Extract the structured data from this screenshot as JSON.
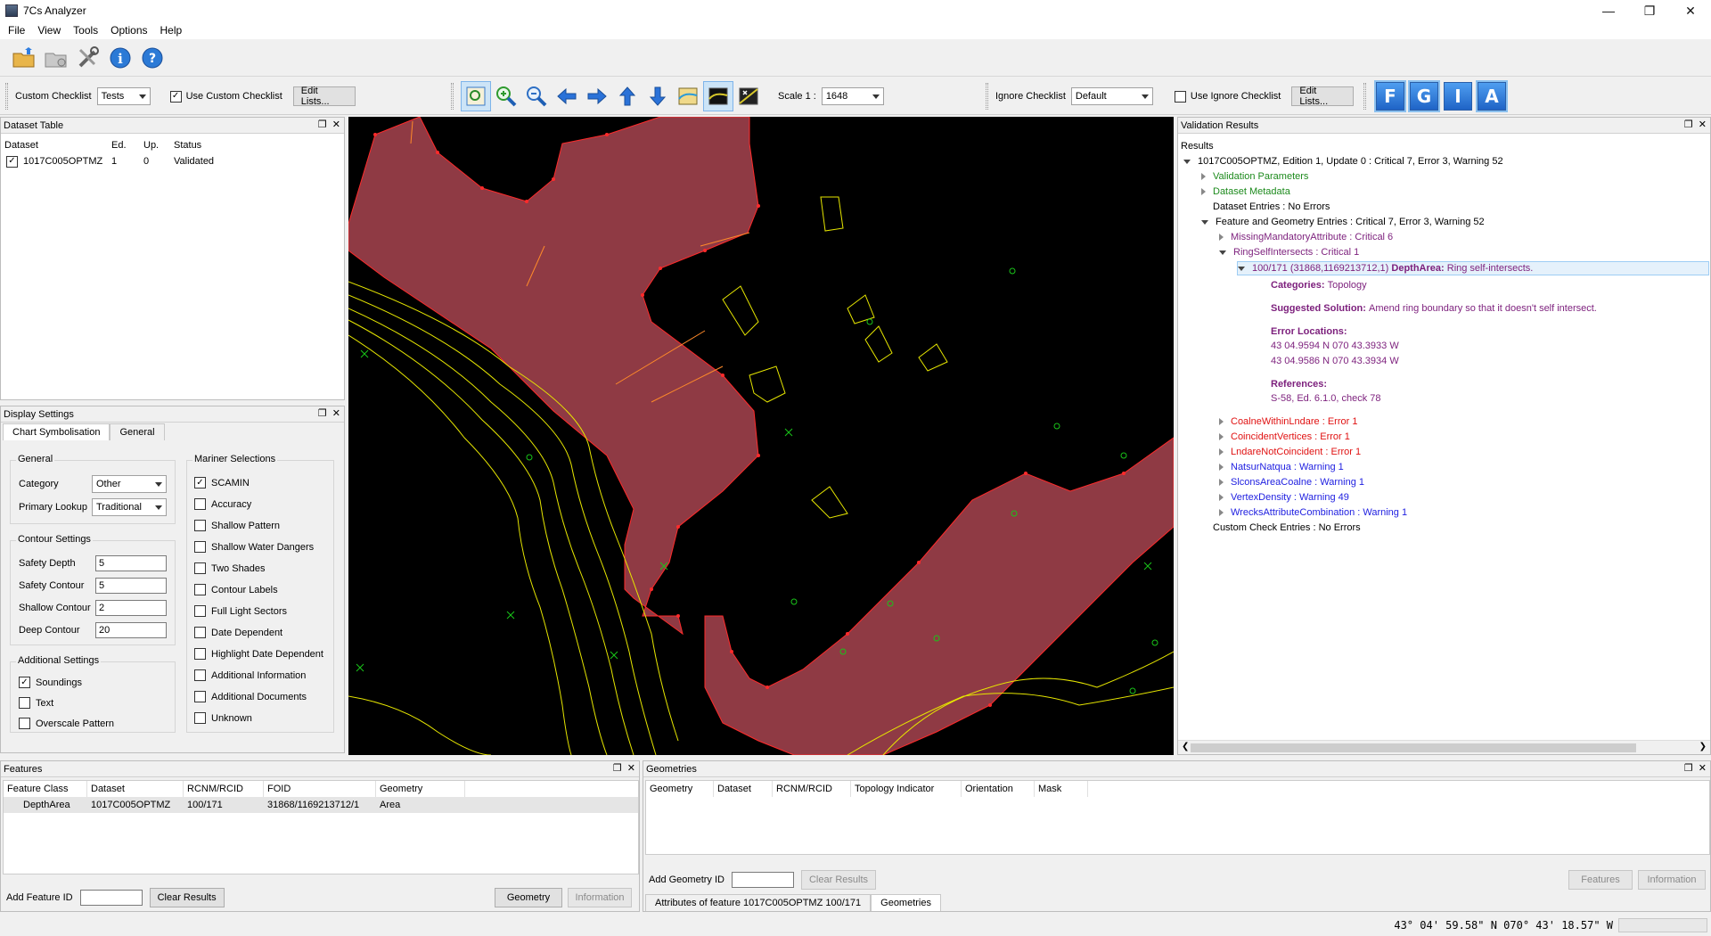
{
  "window": {
    "title": "7Cs Analyzer"
  },
  "menu": [
    "File",
    "View",
    "Tools",
    "Options",
    "Help"
  ],
  "toolbar1": {
    "icons": [
      "open-folder-icon",
      "close-dataset-icon",
      "tools-icon",
      "info-icon",
      "help-icon"
    ]
  },
  "toolbar2": {
    "custom_checklist_label": "Custom Checklist",
    "custom_checklist_value": "Tests",
    "use_custom_checklist_label": "Use Custom Checklist",
    "use_custom_checklist_checked": true,
    "edit_lists_label": "Edit Lists...",
    "scale_label": "Scale 1 :",
    "scale_value": "1648",
    "ignore_checklist_label": "Ignore Checklist",
    "ignore_checklist_value": "Default",
    "use_ignore_checklist_label": "Use Ignore Checklist",
    "use_ignore_checklist_checked": false,
    "edit_lists2_label": "Edit Lists...",
    "letter_buttons": [
      "F",
      "G",
      "I",
      "A"
    ]
  },
  "dataset_table": {
    "title": "Dataset Table",
    "columns": [
      "Dataset",
      "Ed.",
      "Up.",
      "Status"
    ],
    "rows": [
      {
        "dataset": "1017C005OPTMZ",
        "ed": "1",
        "up": "0",
        "status": "Validated",
        "checked": true
      }
    ]
  },
  "display_settings": {
    "title": "Display Settings",
    "tabs": [
      "Chart Symbolisation",
      "General"
    ],
    "general_group": "General",
    "category_label": "Category",
    "category_value": "Other",
    "primary_lookup_label": "Primary Lookup",
    "primary_lookup_value": "Traditional",
    "contour_group": "Contour Settings",
    "safety_depth_label": "Safety Depth",
    "safety_depth_value": "5",
    "safety_contour_label": "Safety Contour",
    "safety_contour_value": "5",
    "shallow_contour_label": "Shallow Contour",
    "shallow_contour_value": "2",
    "deep_contour_label": "Deep Contour",
    "deep_contour_value": "20",
    "additional_group": "Additional Settings",
    "additional": [
      {
        "label": "Soundings",
        "checked": true
      },
      {
        "label": "Text",
        "checked": false
      },
      {
        "label": "Overscale Pattern",
        "checked": false
      }
    ],
    "mariner_group": "Mariner Selections",
    "mariner": [
      {
        "label": "SCAMIN",
        "checked": true
      },
      {
        "label": "Accuracy",
        "checked": false
      },
      {
        "label": "Shallow Pattern",
        "checked": false
      },
      {
        "label": "Shallow Water Dangers",
        "checked": false
      },
      {
        "label": "Two Shades",
        "checked": false
      },
      {
        "label": "Contour Labels",
        "checked": false
      },
      {
        "label": "Full Light Sectors",
        "checked": false
      },
      {
        "label": "Date Dependent",
        "checked": false
      },
      {
        "label": "Highlight Date Dependent",
        "checked": false
      },
      {
        "label": "Additional Information",
        "checked": false
      },
      {
        "label": "Additional Documents",
        "checked": false
      },
      {
        "label": "Unknown",
        "checked": false
      }
    ]
  },
  "validation": {
    "title": "Validation Results",
    "results_label": "Results",
    "root": "1017C005OPTMZ, Edition 1, Update 0 : Critical 7, Error 3, Warning 52",
    "validation_parameters": "Validation Parameters",
    "dataset_metadata": "Dataset Metadata",
    "dataset_entries": "Dataset Entries : No Errors",
    "feature_geometry": "Feature and Geometry Entries : Critical 7, Error 3, Warning 52",
    "missing_mandatory": "MissingMandatoryAttribute : Critical 6",
    "ring_self": "RingSelfIntersects : Critical 1",
    "selected_item_prefix": "100/171 (31868,1169213712,1)",
    "selected_item_bold": "DepthArea:",
    "selected_item_suffix": "Ring self-intersects.",
    "categories_label": "Categories:",
    "categories_value": "Topology",
    "solution_label": "Suggested Solution:",
    "solution_value": "Amend ring boundary so that it doesn't self intersect.",
    "locations_label": "Error Locations:",
    "locations": [
      "43 04.9594 N 070 43.3933 W",
      "43 04.9586 N 070 43.3934 W"
    ],
    "references_label": "References:",
    "references_value": "S-58, Ed. 6.1.0, check 78",
    "checks": [
      {
        "label": "CoalneWithinLndare : Error 1",
        "cls": "red"
      },
      {
        "label": "CoincidentVertices : Error 1",
        "cls": "red"
      },
      {
        "label": "LndareNotCoincident : Error 1",
        "cls": "red"
      },
      {
        "label": "NatsurNatqua : Warning 1",
        "cls": "blue"
      },
      {
        "label": "SlconsAreaCoalne : Warning 1",
        "cls": "blue"
      },
      {
        "label": "VertexDensity : Warning 49",
        "cls": "blue"
      },
      {
        "label": "WrecksAttributeCombination : Warning 1",
        "cls": "blue"
      }
    ],
    "custom_check": "Custom Check Entries : No Errors"
  },
  "features": {
    "title": "Features",
    "columns": [
      "Feature Class",
      "Dataset",
      "RCNM/RCID",
      "FOID",
      "Geometry"
    ],
    "rows": [
      {
        "feature_class": "DepthArea",
        "dataset": "1017C005OPTMZ",
        "rcnm": "100/171",
        "foid": "31868/1169213712/1",
        "geometry": "Area"
      }
    ],
    "add_feature_label": "Add Feature ID",
    "clear_results_label": "Clear Results",
    "geometry_btn": "Geometry",
    "information_btn": "Information"
  },
  "geometries": {
    "title": "Geometries",
    "columns": [
      "Geometry",
      "Dataset",
      "RCNM/RCID",
      "Topology Indicator",
      "Orientation",
      "Mask"
    ],
    "add_geometry_label": "Add Geometry ID",
    "clear_results_label": "Clear Results",
    "features_btn": "Features",
    "information_btn": "Information",
    "tabs": [
      "Attributes of feature 1017C005OPTMZ 100/171",
      "Geometries"
    ]
  },
  "status": {
    "coords": "43° 04' 59.58\" N   070° 43' 18.57\" W"
  },
  "colors": {
    "depth_area": "#8f3a44",
    "contour": "#e6e600",
    "vertex": "#ff2a2a",
    "sounding": "#19c419",
    "map_bg": "#000000"
  }
}
